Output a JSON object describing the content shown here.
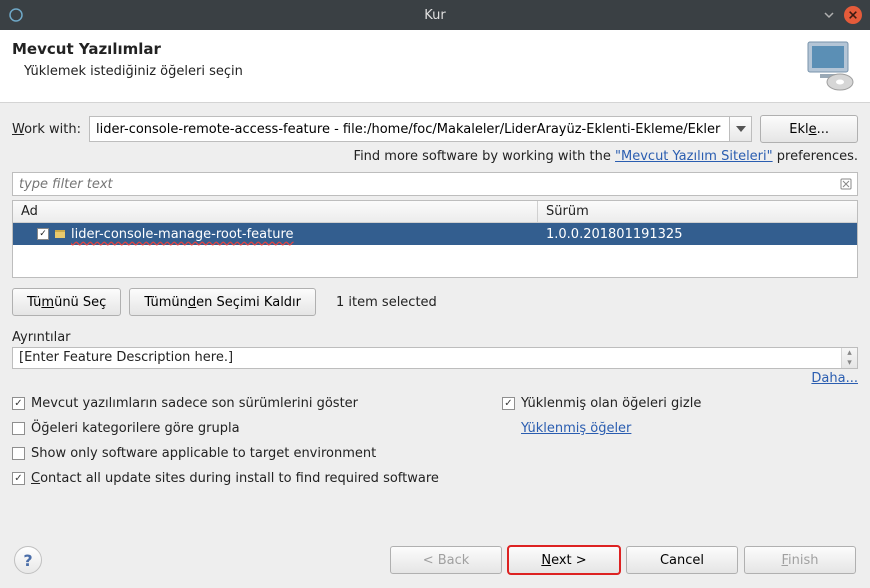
{
  "titlebar": {
    "title": "Kur"
  },
  "header": {
    "title": "Mevcut Yazılımlar",
    "subtitle": "Yüklemek istediğiniz öğeleri seçin"
  },
  "workwith": {
    "label_pre": "W",
    "label_post": "ork with:",
    "value": "lider-console-remote-access-feature - file:/home/foc/Makaleler/LiderArayüz-Eklenti-Ekleme/Ekler",
    "add_label_pre": "Ekl",
    "add_label_u": "e",
    "add_label_post": "..."
  },
  "findmore": {
    "prefix": "Find more software by working with the ",
    "link": "\"Mevcut Yazılım Siteleri\"",
    "suffix": " preferences."
  },
  "filter": {
    "placeholder": "type filter text"
  },
  "table": {
    "col_name": "Ad",
    "col_version": "Sürüm",
    "row": {
      "name": "lider-console-manage-root-feature",
      "version": "1.0.0.201801191325"
    }
  },
  "selection": {
    "select_all_pre": "Tü",
    "select_all_u": "m",
    "select_all_post": "ünü Seç",
    "deselect_all_pre": "Tümün",
    "deselect_all_u": "d",
    "deselect_all_post": "en Seçimi Kaldır",
    "status": "1 item selected"
  },
  "details": {
    "group_label": "Ayrıntılar",
    "desc": "[Enter Feature Description here.]",
    "more_pre": "Dah",
    "more_u": "a",
    "more_post": "..."
  },
  "options": {
    "latest": "Mevcut yazılımların sadece son sürümlerini göster",
    "group": "Öğeleri kategorilere göre grupla",
    "target": "Show only software applicable to target environment",
    "contact_pre": "C",
    "contact_post": "ontact all update sites during install to find required software",
    "hide_installed": "Yüklenmiş olan öğeleri gizle",
    "installed_link": "Yüklenmiş öğeler"
  },
  "footer": {
    "back": "< Back",
    "next_pre": "N",
    "next_post": "ext >",
    "cancel": "Cancel",
    "finish_pre": "F",
    "finish_post": "inish"
  }
}
